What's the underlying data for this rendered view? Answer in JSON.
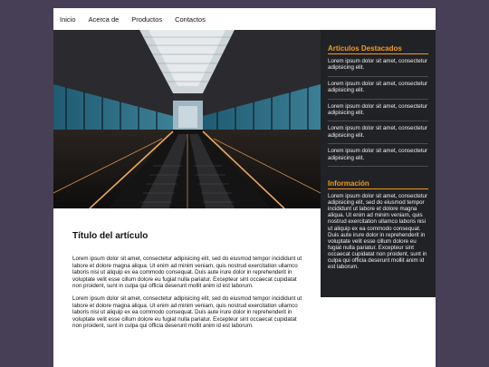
{
  "nav": {
    "items": [
      "Inicio",
      "Acerca de",
      "Productos",
      "Contactos"
    ]
  },
  "sidebar": {
    "featured_heading": "Artículos Destacados",
    "featured_items": [
      "Lorem ipsum dolor sit amet, consectetur adipisicing elit.",
      "Lorem ipsum dolor sit amet, consectetur adipisicing elit.",
      "Lorem ipsum dolor sit amet, consectetur adipisicing elit.",
      "Lorem ipsum dolor sit amet, consectetur adipisicing elit.",
      "Lorem ipsum dolor sit amet, consectetur adipisicing elit."
    ],
    "info_heading": "Información",
    "info_text": "Lorem ipsum dolor sit amet, consectetur adipisicing elit, sed do eiusmod tempor incididunt ut labore et dolore magna aliqua. Ut enim ad minim veniam, quis nostrud exercitation ullamco laboris nisi ut aliquip ex ea commodo consequat. Duis aute irure dolor in reprehenderit in voluptate velit esse cillum dolore eu fugiat nulla pariatur. Excepteur sint occaecat cupidatat non proident, sunt in culpa qui officia deserunt mollit anim id est laborum."
  },
  "article": {
    "title": "Título del artículo",
    "paragraphs": [
      "Lorem ipsum dolor sit amet, consectetur adipisicing elit, sed do eiusmod tempor incididunt ut labore et dolore magna aliqua. Ut enim ad minim veniam, quis nostrud exercitation ullamco laboris nisi ut aliquip ex ea commodo consequat. Duis aute irure dolor in reprehenderit in voluptate velit esse cillum dolore eu fugiat nulla pariatur. Excepteur sint occaecat cupidatat non proident, sunt in culpa qui officia deserunt mollit anim id est laborum.",
      "Lorem ipsum dolor sit amet, consectetur adipisicing elit, sed do eiusmod tempor incididunt ut labore et dolore magna aliqua. Ut enim ad minim veniam, quis nostrud exercitation ullamco laboris nisi ut aliquip ex ea commodo consequat. Duis aute irure dolor in reprehenderit in voluptate velit esse cillum dolore eu fugiat nulla pariatur. Excepteur sint occaecat cupidatat non proident, sunt in culpa qui officia deserunt mollit anim id est laborum."
    ]
  },
  "colors": {
    "background": "#463f56",
    "sidebar": "#212226",
    "accent": "#f29a1d"
  }
}
